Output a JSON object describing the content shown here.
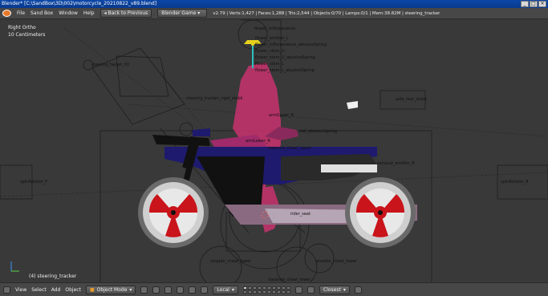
{
  "window": {
    "title": "Blender* [C:\\SandBox\\3D\\002\\motorcycle_20210822_v89.blend]",
    "controls": [
      "_",
      "□",
      "×"
    ]
  },
  "info_header": {
    "menus": [
      "File",
      "Sand Box",
      "Window",
      "Help"
    ],
    "back_button": "Back to Previous",
    "render_engine": "Blender Game",
    "stats": "v2.79 | Verts:1,427 | Faces:1,288 | Tris:2,544 | Objects:0/70 | Lamps:0/1 | Mem:38.82M | steering_tracker"
  },
  "viewport": {
    "view_name": "Right Ortho",
    "scale": "10 Centimeters",
    "active_object": "(4) steering_tracker",
    "labels": {
      "flower_inflorescence": "flower_inflorescence",
      "flower_emitter_l": "flower_emitter_L",
      "flower_inflorescence_abusive": "flower_inflorescence_abusiveSpring",
      "flower_stem_u": "flower_stem_U",
      "flower_stem_u_abusive": "flower_stem_U_abusiveSpring",
      "flower_stem_l": "flower_stem_L",
      "flower_stem_l_abusive": "flower_stem_L_abusiveSpring",
      "steering_target_02": "steering_target_02",
      "steering_tracker_rigid": "steering_tracker_rigid_stabil",
      "arm_upper_r": "armUpper_R",
      "tail_abusive": "tail_abusiveSpring",
      "arm_lower_r": "armLower_R",
      "balance_cheat_upper": "balance_cheat_upper",
      "exhaust_emitter_r": "exhaust_emitter_R",
      "axle_rear_static": "axle_rear_static",
      "spin_rotator_f": "spinRotator_F",
      "spin_rotator_r": "spinRotator_R",
      "rider_seat": "rider_seat",
      "stopple_cheat_lower": "stopple_cheat_lower",
      "wheelie_cheat_lower": "wheelie_cheat_lower",
      "balance_cheat_lower": "balance_cheat_lower"
    }
  },
  "footer": {
    "menus": [
      "View",
      "Select",
      "Add",
      "Object"
    ],
    "mode": "Object Mode",
    "orientation": "Local",
    "snap": "Closest"
  }
}
